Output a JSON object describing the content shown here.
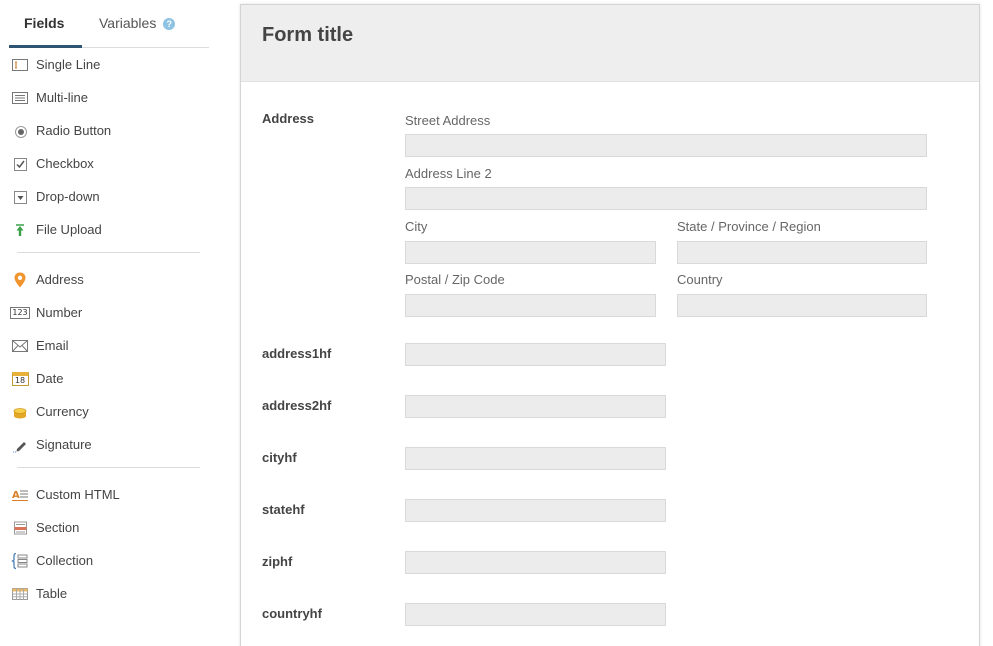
{
  "sidebar": {
    "tabs": {
      "fields": "Fields",
      "variables": "Variables",
      "help": "?"
    },
    "basic_fields": [
      {
        "label": "Single Line",
        "icon": "single-line-icon"
      },
      {
        "label": "Multi-line",
        "icon": "multi-line-icon"
      },
      {
        "label": "Radio Button",
        "icon": "radio-button-icon"
      },
      {
        "label": "Checkbox",
        "icon": "checkbox-icon"
      },
      {
        "label": "Drop-down",
        "icon": "dropdown-icon"
      },
      {
        "label": "File Upload",
        "icon": "file-upload-icon"
      }
    ],
    "advanced_fields": [
      {
        "label": "Address",
        "icon": "address-pin-icon"
      },
      {
        "label": "Number",
        "icon": "number-icon",
        "glyph": "123"
      },
      {
        "label": "Email",
        "icon": "email-icon"
      },
      {
        "label": "Date",
        "icon": "date-icon",
        "glyph": "18"
      },
      {
        "label": "Currency",
        "icon": "currency-icon"
      },
      {
        "label": "Signature",
        "icon": "signature-icon"
      }
    ],
    "layout_fields": [
      {
        "label": "Custom HTML",
        "icon": "custom-html-icon"
      },
      {
        "label": "Section",
        "icon": "section-icon"
      },
      {
        "label": "Collection",
        "icon": "collection-icon"
      },
      {
        "label": "Table",
        "icon": "table-icon"
      }
    ]
  },
  "form": {
    "title": "Form title",
    "address": {
      "label": "Address",
      "street": "Street Address",
      "line2": "Address Line 2",
      "city": "City",
      "state": "State / Province / Region",
      "postal": "Postal / Zip Code",
      "country": "Country"
    },
    "hidden_fields": [
      "address1hf",
      "address2hf",
      "cityhf",
      "statehf",
      "ziphf",
      "countryhf"
    ]
  },
  "colors": {
    "tab_underline": "#2f5471",
    "address_pin": "#f0942e",
    "upload_arrow": "#3aa14a",
    "input_bg": "#ececec"
  }
}
